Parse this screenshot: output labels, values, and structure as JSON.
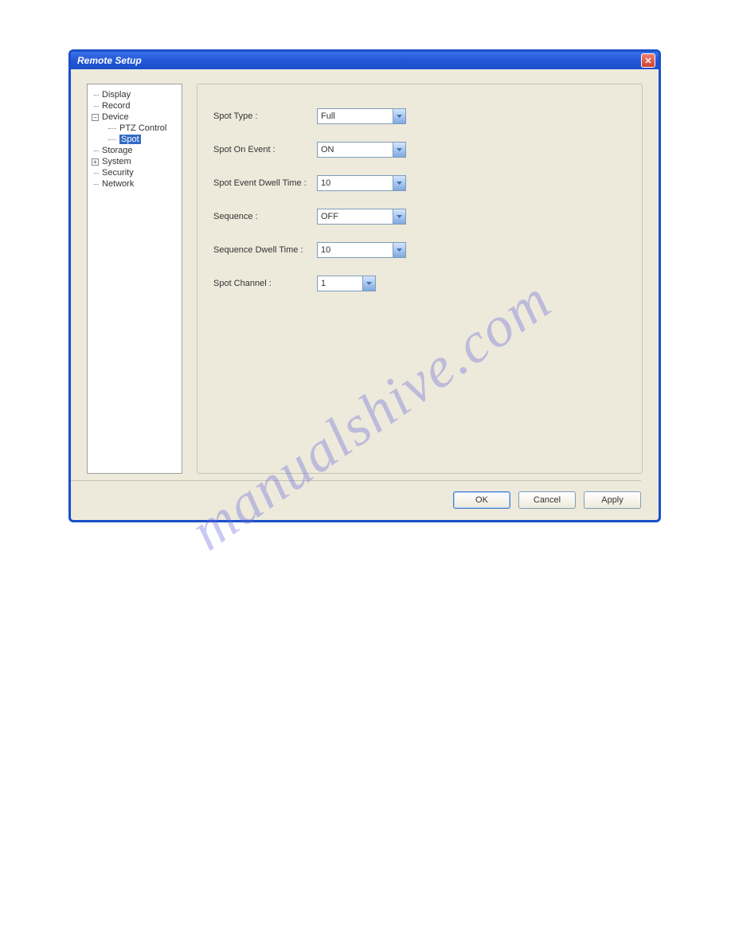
{
  "window": {
    "title": "Remote Setup"
  },
  "tree": {
    "display": "Display",
    "record": "Record",
    "device": "Device",
    "ptz_control": "PTZ Control",
    "spot": "Spot",
    "storage": "Storage",
    "system": "System",
    "security": "Security",
    "network": "Network"
  },
  "form": {
    "spot_type": {
      "label": "Spot Type :",
      "value": "Full"
    },
    "spot_on_event": {
      "label": "Spot On Event :",
      "value": "ON"
    },
    "spot_event_dwell_time": {
      "label": "Spot Event Dwell Time :",
      "value": "10"
    },
    "sequence": {
      "label": "Sequence :",
      "value": "OFF"
    },
    "sequence_dwell_time": {
      "label": "Sequence Dwell Time :",
      "value": "10"
    },
    "spot_channel": {
      "label": "Spot Channel :",
      "value": "1"
    }
  },
  "buttons": {
    "ok": "OK",
    "cancel": "Cancel",
    "apply": "Apply"
  },
  "watermark": "manualshive.com"
}
